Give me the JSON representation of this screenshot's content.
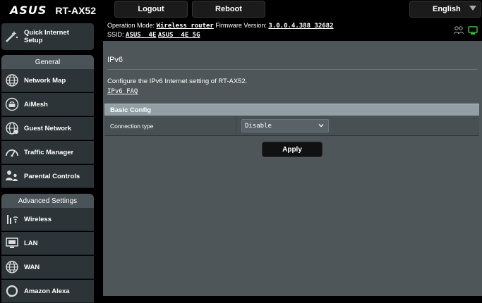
{
  "brand": {
    "logo_text": "ASUS",
    "model": "RT-AX52"
  },
  "topbar": {
    "logout_label": "Logout",
    "reboot_label": "Reboot",
    "language": "English"
  },
  "info": {
    "op_mode_label": "Operation Mode:",
    "op_mode_value": "Wireless router",
    "firmware_label": "Firmware Version:",
    "firmware_value": "3.0.0.4.388_32682",
    "ssid_label": "SSID:",
    "ssid_1": "ASUS _4E",
    "ssid_2": "ASUS _4E_5G"
  },
  "sidebar": {
    "qis_line1": "Quick Internet",
    "qis_line2": "Setup",
    "general_header": "General",
    "general_items": [
      {
        "label": "Network Map",
        "icon": "network-map-icon"
      },
      {
        "label": "AiMesh",
        "icon": "aimesh-icon"
      },
      {
        "label": "Guest Network",
        "icon": "guest-network-icon"
      },
      {
        "label": "Traffic Manager",
        "icon": "traffic-manager-icon"
      },
      {
        "label": "Parental Controls",
        "icon": "parental-controls-icon"
      }
    ],
    "advanced_header": "Advanced Settings",
    "advanced_items": [
      {
        "label": "Wireless",
        "icon": "wireless-icon"
      },
      {
        "label": "LAN",
        "icon": "lan-icon"
      },
      {
        "label": "WAN",
        "icon": "wan-icon"
      },
      {
        "label": "Amazon Alexa",
        "icon": "alexa-icon"
      }
    ]
  },
  "main": {
    "title": "IPv6",
    "description": "Configure the IPv6 Internet setting of RT-AX52.",
    "faq_link": "IPv6 FAQ",
    "section_header": "Basic Config",
    "connection_type_label": "Connection type",
    "connection_type_value": "Disable",
    "apply_label": "Apply"
  },
  "colors": {
    "panel": "#4e5659",
    "sidebar_item": "#2c3437",
    "section_header": "#92a0a5",
    "status_green": "#3fbf3f"
  }
}
